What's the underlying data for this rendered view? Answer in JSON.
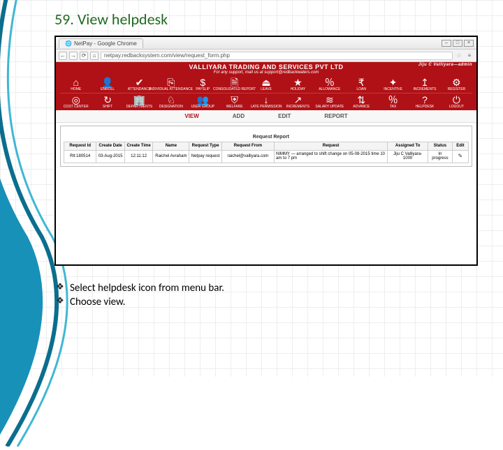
{
  "slide": {
    "title": "59. View helpdesk",
    "bullets": [
      "Select helpdesk icon from menu bar.",
      "Choose view."
    ]
  },
  "browser": {
    "window_title": "NetPay - Google Chrome",
    "url": "netpay.redbacksystem.com/view/request_form.php"
  },
  "app": {
    "company": "VALLIYARA TRADING AND SERVICES PVT LTD",
    "welcome_user": "Jiju C Valliyara—admin",
    "support_note": "For any support, mail us at support@redbackwaters.com",
    "nav_row1": [
      {
        "label": "HOME",
        "glyph": "⌂"
      },
      {
        "label": "ENROLL",
        "glyph": "👤"
      },
      {
        "label": "ATTENDANCE",
        "glyph": "✔"
      },
      {
        "label": "INDIVIDUAL ATTENDANCE",
        "glyph": "⎘"
      },
      {
        "label": "PAYSLIP",
        "glyph": "$"
      },
      {
        "label": "CONSOLIDATED REPORT",
        "glyph": "🗎"
      },
      {
        "label": "LEAVE",
        "glyph": "⏏"
      },
      {
        "label": "HOLIDAY",
        "glyph": "★"
      },
      {
        "label": "ALLOWANCE",
        "glyph": "％"
      },
      {
        "label": "LOAN",
        "glyph": "₹"
      },
      {
        "label": "INCENTIVE",
        "glyph": "✦"
      },
      {
        "label": "INCREMENTS",
        "glyph": "↥"
      },
      {
        "label": "REGISTER",
        "glyph": "⚙"
      }
    ],
    "nav_row2": [
      {
        "label": "COST CENTER",
        "glyph": "◎"
      },
      {
        "label": "SHIFT",
        "glyph": "↻"
      },
      {
        "label": "DEPARTMENTS",
        "glyph": "🏢"
      },
      {
        "label": "DESIGNATION",
        "glyph": "♘"
      },
      {
        "label": "USER GROUP",
        "glyph": "👥"
      },
      {
        "label": "WELFARE",
        "glyph": "⛨"
      },
      {
        "label": "LATE PERMISSION",
        "glyph": "↓"
      },
      {
        "label": "INCREMENTS",
        "glyph": "↗"
      },
      {
        "label": "SALARY UPDATE",
        "glyph": "≋"
      },
      {
        "label": "ADVANCE",
        "glyph": "⇅"
      },
      {
        "label": "TAX",
        "glyph": "％"
      },
      {
        "label": "HELPDESK",
        "glyph": "?"
      },
      {
        "label": "LOGOUT",
        "glyph": "⏻"
      }
    ],
    "actions": {
      "view": "VIEW",
      "add": "ADD",
      "edit": "EDIT",
      "report": "REPORT"
    },
    "report": {
      "legend": "Request Report",
      "headers": {
        "req_id": "Request Id",
        "create_date": "Create Date",
        "create_time": "Create Time",
        "name": "Name",
        "req_type": "Request Type",
        "req_from": "Request From",
        "request": "Request",
        "assigned_to": "Assigned To",
        "status": "Status",
        "edit": "Edit"
      },
      "rows": [
        {
          "req_id": "Rlt:180514",
          "create_date": "03-Aug-2015",
          "create_time": "12:11:12",
          "name": "Raichel Avraham",
          "req_type": "Netpay request",
          "req_from": "raichel@valliyara.com",
          "request": "NIMMY — arranged to shift change on 05-08-2015 time 10 am to 7 pm",
          "assigned_to": "Jiju C Valliyara-1000",
          "status": "In progress"
        }
      ]
    }
  }
}
